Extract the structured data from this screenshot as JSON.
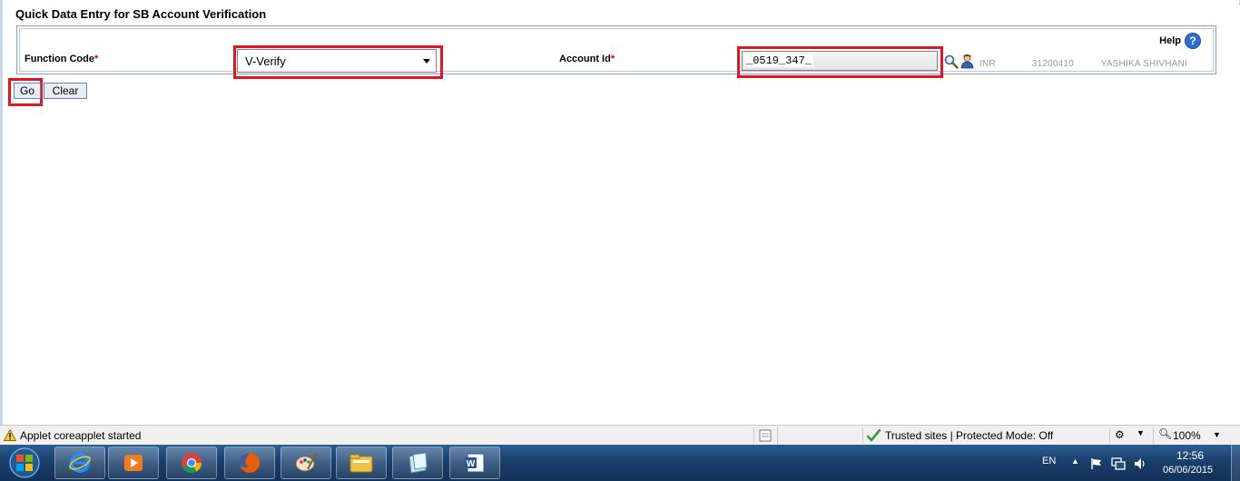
{
  "page": {
    "title": "Quick Data Entry for SB Account Verification",
    "help_label": "Help",
    "help_glyph": "?"
  },
  "form": {
    "function_code_label": "Function Code",
    "function_code_value": "V-Verify",
    "account_id_label": "Account Id",
    "account_id_value": "_0519_347_",
    "required_marker": "*",
    "account_currency": "INR",
    "account_ref": "31200410",
    "account_holder": "YASHIKA SHIVHANI"
  },
  "buttons": {
    "go": "Go",
    "clear": "Clear"
  },
  "statusbar": {
    "message": "Applet coreapplet started",
    "zone": "Trusted sites | Protected Mode: Off",
    "zoom": "100%"
  },
  "taskbar": {
    "apps": [
      "internet-explorer-icon",
      "media-player-icon",
      "chrome-icon",
      "firefox-icon",
      "paint-icon",
      "file-explorer-icon",
      "notes-icon",
      "word-icon"
    ],
    "language": "EN",
    "time": "12:56",
    "date": "06/06/2015"
  },
  "colors": {
    "highlight": "#e3151f",
    "required": "#d00000",
    "help_blue": "#2a6fd6",
    "taskbar": "#1a3f6b"
  }
}
